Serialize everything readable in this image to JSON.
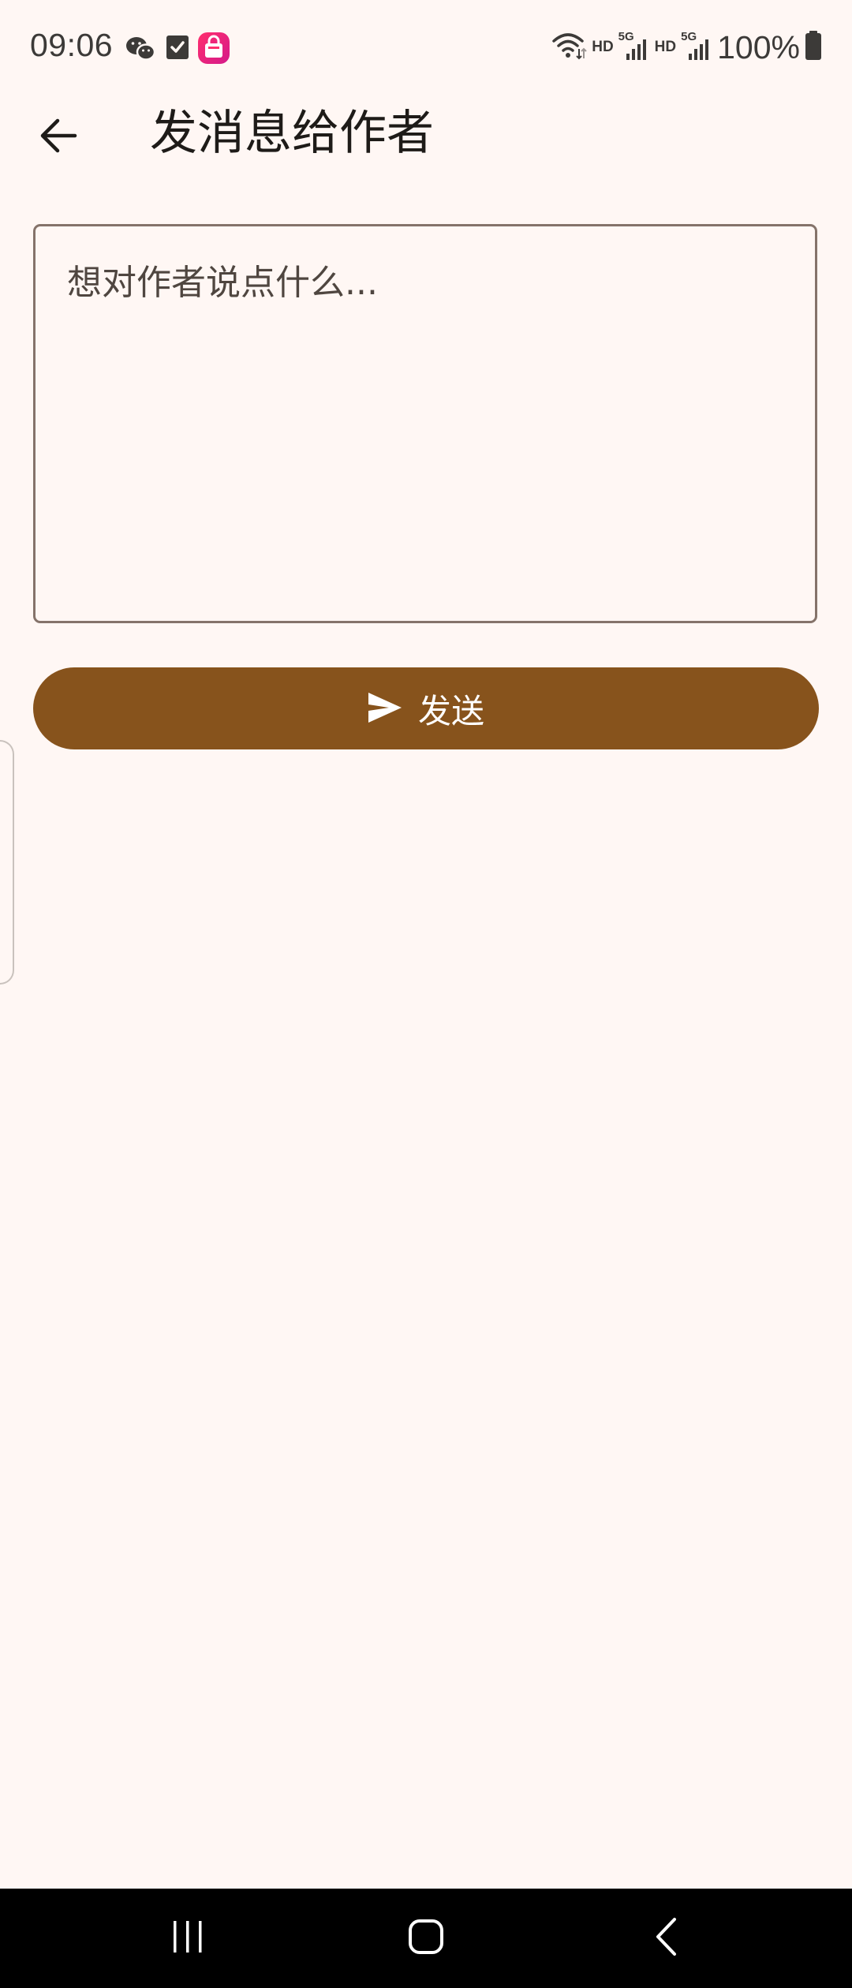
{
  "status_bar": {
    "time": "09:06",
    "left_icons": [
      "wechat-icon",
      "checkbox-notification-icon",
      "shopping-bag-app-icon"
    ],
    "hd_label_1": "HD",
    "hd_label_2": "HD",
    "network_type_1": "5G",
    "network_type_2": "5G",
    "battery": "100%"
  },
  "app_bar": {
    "back_icon": "arrow-back-icon",
    "title": "发消息给作者"
  },
  "message": {
    "placeholder": "想对作者说点什么...",
    "value": ""
  },
  "send_button": {
    "icon": "send-icon",
    "label": "发送"
  },
  "nav_bar": {
    "items": [
      "recent-apps-icon",
      "home-icon",
      "back-icon"
    ]
  },
  "colors": {
    "background": "#fff7f4",
    "accent": "#87531c",
    "outline": "#85736a",
    "nav_background": "#000000"
  }
}
